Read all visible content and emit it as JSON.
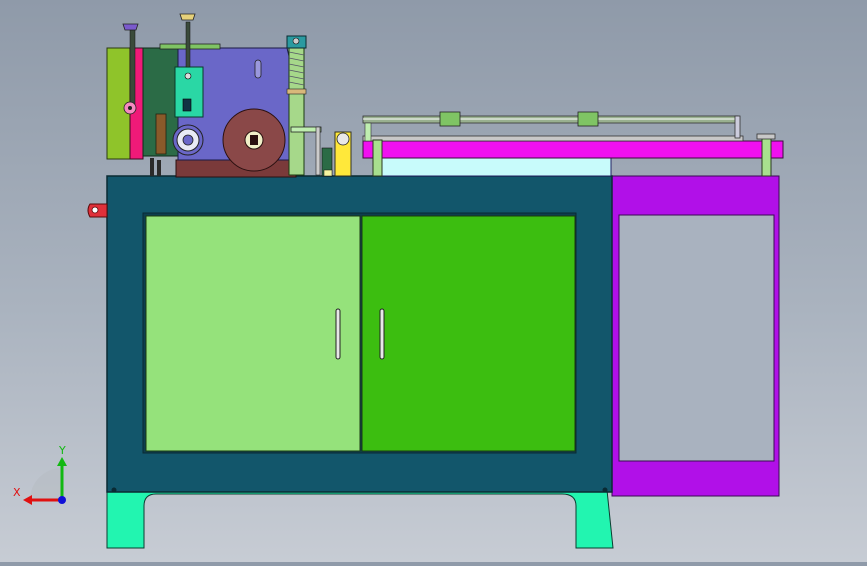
{
  "viewport": {
    "background_top": "#8f9aa9",
    "background_bottom": "#c7ccd4"
  },
  "axis_triad": {
    "x_label": "X",
    "y_label": "Y",
    "x_color": "#e01010",
    "y_color": "#12b812",
    "z_color": "#1010d8"
  },
  "model": {
    "cabinet_color": "#12566b",
    "left_door_color": "#95e27b",
    "right_door_color": "#3cbe10",
    "side_panel_color": "#b110e8",
    "legs_color": "#22f5b0",
    "table_rail_color": "#f010f0",
    "head_plate_color": "#6a67c8"
  }
}
